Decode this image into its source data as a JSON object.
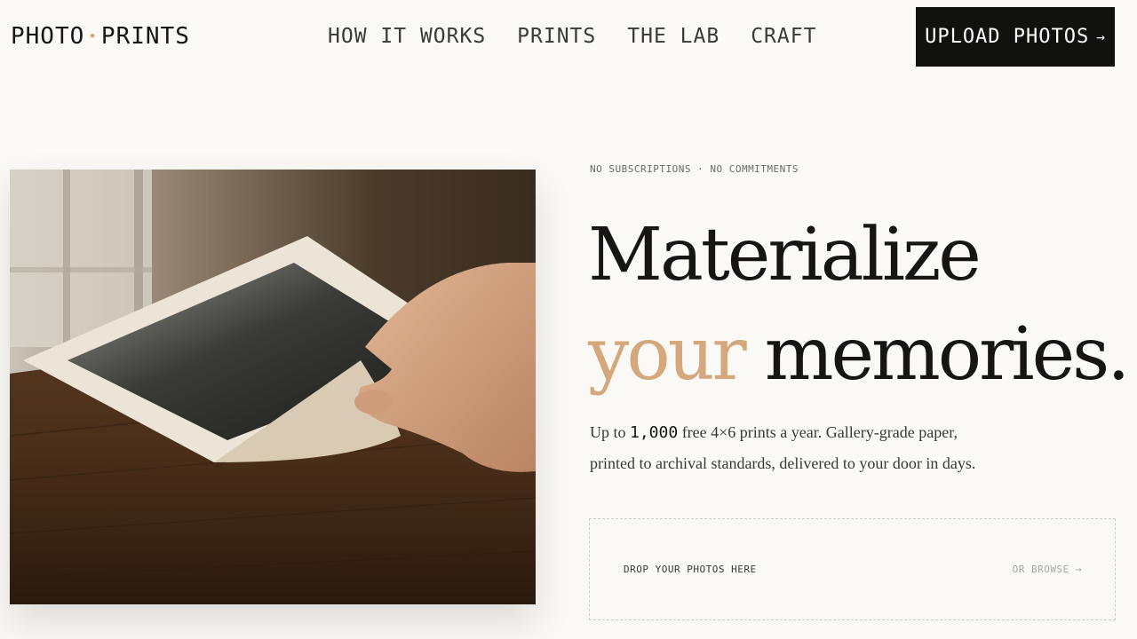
{
  "brand": {
    "part1": "PHOTO",
    "part2": "PRINTS"
  },
  "nav": {
    "items": [
      {
        "label": "HOW IT WORKS"
      },
      {
        "label": "PRINTS"
      },
      {
        "label": "THE LAB"
      },
      {
        "label": "CRAFT"
      }
    ]
  },
  "cta": {
    "label": "UPLOAD PHOTOS",
    "arrow": "→"
  },
  "hero": {
    "eyebrow": "NO SUBSCRIPTIONS · NO COMMITMENTS",
    "headline_line1": "Materialize",
    "headline_accent": "your",
    "headline_rest": " memories.",
    "body_prefix": "Up to ",
    "body_number": "1,000",
    "body_suffix": " free 4×6 prints a year. Gallery-grade paper, printed to archival standards, delivered to your door in days."
  },
  "dropzone": {
    "label": "DROP YOUR PHOTOS HERE",
    "browse": "OR BROWSE →"
  },
  "colors": {
    "accent": "#d4a77c",
    "ink": "#161514",
    "background": "#fbf9f6",
    "button": "#111110"
  }
}
